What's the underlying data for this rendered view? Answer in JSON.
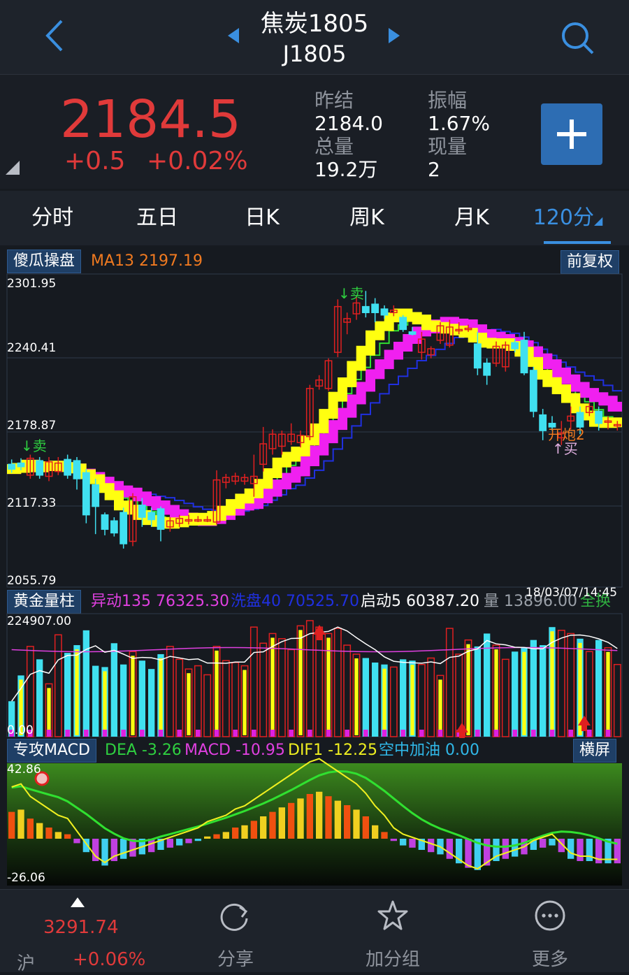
{
  "header": {
    "title": "焦炭1805",
    "code": "J1805"
  },
  "quote": {
    "price": "2184.5",
    "change": "+0.5",
    "change_pct": "+0.02%",
    "prev_close_label": "昨结",
    "prev_close": "2184.0",
    "amplitude_label": "振幅",
    "amplitude": "1.67%",
    "volume_label": "总量",
    "volume": "19.2万",
    "current_vol_label": "现量",
    "current_vol": "2"
  },
  "tabs": [
    "分时",
    "五日",
    "日K",
    "周K",
    "月K",
    "120分"
  ],
  "main_panel": {
    "indicator_name": "傻瓜操盘",
    "ma_text": "MA13  2197.19",
    "adjust_button": "前复权",
    "y_labels": [
      "2301.95",
      "2240.41",
      "2178.87",
      "2117.33",
      "2055.79"
    ],
    "signals": {
      "sell1": "↓卖",
      "sell2": "↓卖",
      "open": "开炮2",
      "buy": "↑买"
    }
  },
  "volume_panel": {
    "indicator_name": "黄金量柱",
    "yidong": "异动135  76325.30",
    "xipan": "洗盘40  70525.70",
    "qidong": "启动5  60387.20",
    "liang": "量  13896.00",
    "quanhuan": "全换",
    "timestamp": "18/03/07/14:45",
    "y_top": "224907.00",
    "y_bottom": "0.00"
  },
  "macd_panel": {
    "indicator_name": "专攻MACD",
    "dea": "DEA  -3.26",
    "macd": "MACD  -10.95",
    "dif": "DIF1  -12.25",
    "kzjy": "空中加油  0.00",
    "landscape_button": "横屏",
    "y_top": "42.86",
    "y_bottom": "-26.06"
  },
  "bottom_bar": {
    "index_value": "3291.74",
    "index_name": "沪",
    "index_change": "+0.06%",
    "share": "分享",
    "add_group": "加分组",
    "more": "更多"
  },
  "chart_data": {
    "type": "candlestick",
    "price_range": [
      2055.79,
      2301.95
    ],
    "candles": [
      {
        "o": 2152,
        "c": 2148,
        "h": 2156,
        "l": 2145
      },
      {
        "o": 2153,
        "c": 2150,
        "h": 2157,
        "l": 2147
      },
      {
        "o": 2143,
        "c": 2157,
        "h": 2160,
        "l": 2140
      },
      {
        "o": 2155,
        "c": 2143,
        "h": 2158,
        "l": 2140
      },
      {
        "o": 2142,
        "c": 2154,
        "h": 2158,
        "l": 2138
      },
      {
        "o": 2146,
        "c": 2153,
        "h": 2158,
        "l": 2143
      },
      {
        "o": 2156,
        "c": 2143,
        "h": 2160,
        "l": 2140
      },
      {
        "o": 2155,
        "c": 2140,
        "h": 2158,
        "l": 2131
      },
      {
        "o": 2145,
        "c": 2110,
        "h": 2148,
        "l": 2103
      },
      {
        "o": 2135,
        "c": 2117,
        "h": 2140,
        "l": 2094
      },
      {
        "o": 2110,
        "c": 2098,
        "h": 2112,
        "l": 2093
      },
      {
        "o": 2105,
        "c": 2095,
        "h": 2108,
        "l": 2092
      },
      {
        "o": 2112,
        "c": 2086,
        "h": 2116,
        "l": 2082
      },
      {
        "o": 2088,
        "c": 2125,
        "h": 2128,
        "l": 2084
      },
      {
        "o": 2118,
        "c": 2108,
        "h": 2124,
        "l": 2100
      },
      {
        "o": 2112,
        "c": 2106,
        "h": 2116,
        "l": 2100
      },
      {
        "o": 2115,
        "c": 2098,
        "h": 2117,
        "l": 2088
      },
      {
        "o": 2100,
        "c": 2105,
        "h": 2108,
        "l": 2096
      },
      {
        "o": 2103,
        "c": 2107,
        "h": 2110,
        "l": 2100
      },
      {
        "o": 2106,
        "c": 2106,
        "h": 2110,
        "l": 2102
      },
      {
        "o": 2106,
        "c": 2106,
        "h": 2109,
        "l": 2104
      },
      {
        "o": 2106,
        "c": 2106,
        "h": 2109,
        "l": 2104
      },
      {
        "o": 2104,
        "c": 2139,
        "h": 2147,
        "l": 2102
      },
      {
        "o": 2137,
        "c": 2141,
        "h": 2144,
        "l": 2132
      },
      {
        "o": 2138,
        "c": 2142,
        "h": 2145,
        "l": 2135
      },
      {
        "o": 2138,
        "c": 2141,
        "h": 2144,
        "l": 2135
      },
      {
        "o": 2136,
        "c": 2142,
        "h": 2160,
        "l": 2125
      },
      {
        "o": 2152,
        "c": 2169,
        "h": 2183,
        "l": 2146
      },
      {
        "o": 2165,
        "c": 2177,
        "h": 2181,
        "l": 2160
      },
      {
        "o": 2167,
        "c": 2177,
        "h": 2180,
        "l": 2160
      },
      {
        "o": 2171,
        "c": 2177,
        "h": 2186,
        "l": 2168
      },
      {
        "o": 2170,
        "c": 2176,
        "h": 2180,
        "l": 2166
      },
      {
        "o": 2175,
        "c": 2215,
        "h": 2218,
        "l": 2172
      },
      {
        "o": 2217,
        "c": 2222,
        "h": 2226,
        "l": 2214
      },
      {
        "o": 2215,
        "c": 2238,
        "h": 2240,
        "l": 2213
      },
      {
        "o": 2245,
        "c": 2283,
        "h": 2289,
        "l": 2241
      },
      {
        "o": 2270,
        "c": 2273,
        "h": 2278,
        "l": 2260
      },
      {
        "o": 2277,
        "c": 2286,
        "h": 2292,
        "l": 2272
      },
      {
        "o": 2283,
        "c": 2278,
        "h": 2296,
        "l": 2274
      },
      {
        "o": 2285,
        "c": 2278,
        "h": 2290,
        "l": 2270
      },
      {
        "o": 2281,
        "c": 2276,
        "h": 2284,
        "l": 2273
      },
      {
        "o": 2278,
        "c": 2280,
        "h": 2284,
        "l": 2275
      },
      {
        "o": 2274,
        "c": 2264,
        "h": 2276,
        "l": 2262
      },
      {
        "o": 2262,
        "c": 2260,
        "h": 2266,
        "l": 2259
      },
      {
        "o": 2245,
        "c": 2256,
        "h": 2262,
        "l": 2239
      },
      {
        "o": 2243,
        "c": 2248,
        "h": 2250,
        "l": 2240
      },
      {
        "o": 2255,
        "c": 2267,
        "h": 2270,
        "l": 2252
      },
      {
        "o": 2251,
        "c": 2266,
        "h": 2272,
        "l": 2249
      },
      {
        "o": 2264,
        "c": 2264,
        "h": 2270,
        "l": 2260
      },
      {
        "o": 2265,
        "c": 2265,
        "h": 2268,
        "l": 2262
      },
      {
        "o": 2252,
        "c": 2232,
        "h": 2262,
        "l": 2226
      },
      {
        "o": 2236,
        "c": 2226,
        "h": 2240,
        "l": 2218
      },
      {
        "o": 2236,
        "c": 2250,
        "h": 2254,
        "l": 2233
      },
      {
        "o": 2233,
        "c": 2251,
        "h": 2254,
        "l": 2229
      },
      {
        "o": 2253,
        "c": 2248,
        "h": 2256,
        "l": 2245
      },
      {
        "o": 2255,
        "c": 2228,
        "h": 2262,
        "l": 2226
      },
      {
        "o": 2230,
        "c": 2196,
        "h": 2233,
        "l": 2191
      },
      {
        "o": 2193,
        "c": 2180,
        "h": 2198,
        "l": 2172
      },
      {
        "o": 2186,
        "c": 2183,
        "h": 2192,
        "l": 2180
      },
      {
        "o": 2174,
        "c": 2178,
        "h": 2188,
        "l": 2168
      },
      {
        "o": 2188,
        "c": 2192,
        "h": 2200,
        "l": 2181
      },
      {
        "o": 2195,
        "c": 2183,
        "h": 2200,
        "l": 2177
      },
      {
        "o": 2195,
        "c": 2200,
        "h": 2203,
        "l": 2192
      },
      {
        "o": 2196,
        "c": 2186,
        "h": 2200,
        "l": 2180
      },
      {
        "o": 2188,
        "c": 2188,
        "h": 2192,
        "l": 2181
      },
      {
        "o": 2184,
        "c": 2185,
        "h": 2188,
        "l": 2180
      }
    ],
    "volume": [
      55,
      95,
      140,
      120,
      82,
      158,
      130,
      142,
      165,
      110,
      108,
      145,
      112,
      132,
      118,
      105,
      128,
      140,
      120,
      105,
      110,
      96,
      140,
      118,
      115,
      110,
      170,
      145,
      160,
      152,
      135,
      172,
      180,
      170,
      160,
      168,
      142,
      128,
      122,
      115,
      112,
      108,
      120,
      118,
      112,
      122,
      95,
      168,
      128,
      150,
      140,
      160,
      142,
      120,
      132,
      138,
      150,
      142,
      170,
      165,
      160,
      152,
      132,
      150,
      138,
      112
    ],
    "macd": [
      12,
      13,
      9,
      7,
      5,
      3,
      2,
      -2,
      -6,
      -10,
      -12,
      -10,
      -9,
      -8,
      -7,
      -6,
      -5,
      -4,
      -3,
      -2,
      -1,
      1,
      2,
      3,
      5,
      6,
      8,
      10,
      12,
      14,
      16,
      18,
      20,
      21,
      19,
      17,
      15,
      13,
      10,
      6,
      3,
      -1,
      -3,
      -4,
      -5,
      -6,
      -7,
      -9,
      -11,
      -13,
      -14,
      -12,
      -10,
      -9,
      -8,
      -7,
      -5,
      -4,
      -3,
      -6,
      -9,
      -10,
      -10,
      -11,
      -11,
      -11
    ]
  }
}
